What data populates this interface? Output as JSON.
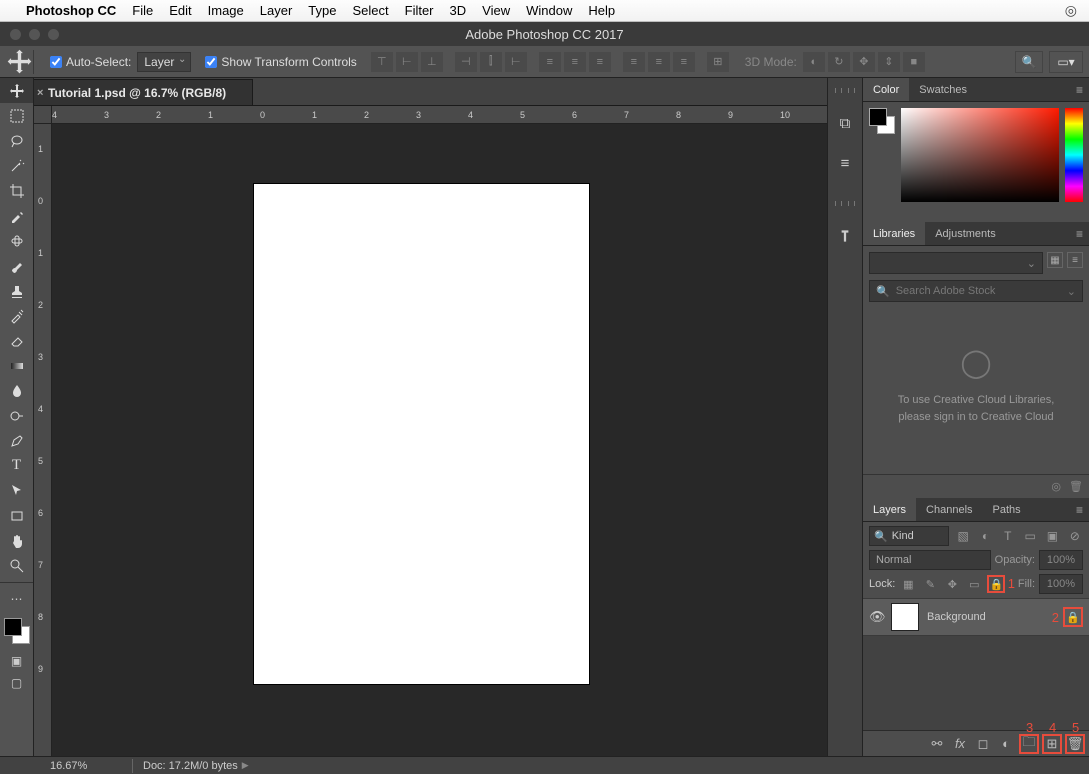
{
  "mac_menu": {
    "app": "Photoshop CC",
    "items": [
      "File",
      "Edit",
      "Image",
      "Layer",
      "Type",
      "Select",
      "Filter",
      "3D",
      "View",
      "Window",
      "Help"
    ]
  },
  "window": {
    "title": "Adobe Photoshop CC 2017"
  },
  "options": {
    "auto_select_label": "Auto-Select:",
    "auto_select_target": "Layer",
    "show_transform": "Show Transform Controls",
    "mode_label": "3D Mode:"
  },
  "document": {
    "tab_label": "Tutorial 1.psd @ 16.7% (RGB/8)"
  },
  "ruler_h": [
    "4",
    "3",
    "2",
    "1",
    "0",
    "1",
    "2",
    "3",
    "4",
    "5",
    "6",
    "7",
    "8",
    "9",
    "10"
  ],
  "ruler_v": [
    "1",
    "0",
    "1",
    "2",
    "3",
    "4",
    "5",
    "6",
    "7",
    "8",
    "9"
  ],
  "panels": {
    "color": {
      "tab1": "Color",
      "tab2": "Swatches"
    },
    "libraries": {
      "tab1": "Libraries",
      "tab2": "Adjustments",
      "search_placeholder": "Search Adobe Stock",
      "msg1": "To use Creative Cloud Libraries,",
      "msg2": "please sign in to Creative Cloud"
    },
    "layers": {
      "tab1": "Layers",
      "tab2": "Channels",
      "tab3": "Paths",
      "kind": "Kind",
      "blend_mode": "Normal",
      "opacity_label": "Opacity:",
      "opacity_value": "100%",
      "lock_label": "Lock:",
      "fill_label": "Fill:",
      "fill_value": "100%",
      "background_layer": "Background"
    }
  },
  "annotations": {
    "a1": "1",
    "a2": "2",
    "a3": "3",
    "a4": "4",
    "a5": "5"
  },
  "status": {
    "zoom": "16.67%",
    "doc": "Doc: 17.2M/0 bytes"
  }
}
